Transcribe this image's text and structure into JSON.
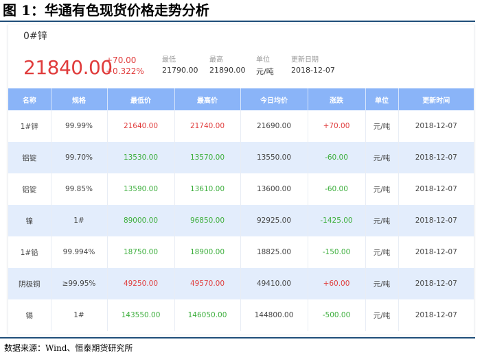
{
  "figure_title": "图 1：华通有色现货价格走势分析",
  "summary": {
    "product": "0#锌",
    "price": "21840.00",
    "change": "+70.00",
    "change_pct": "+0.322%",
    "low_label": "最低",
    "low_value": "21790.00",
    "high_label": "最高",
    "high_value": "21890.00",
    "unit_label": "单位",
    "unit_value": "元/吨",
    "date_label": "更新日期",
    "date_value": "2018-12-07"
  },
  "table": {
    "headers": [
      "名称",
      "规格",
      "最低价",
      "最高价",
      "今日均价",
      "涨跌",
      "单位",
      "更新时间"
    ],
    "rows": [
      {
        "name": "1#锌",
        "spec": "99.99%",
        "low": "21640.00",
        "high": "21740.00",
        "avg": "21690.00",
        "chg": "+70.00",
        "unit": "元/吨",
        "time": "2018-12-07",
        "dir": "up"
      },
      {
        "name": "铝锭",
        "spec": "99.70%",
        "low": "13530.00",
        "high": "13570.00",
        "avg": "13550.00",
        "chg": "-60.00",
        "unit": "元/吨",
        "time": "2018-12-07",
        "dir": "down"
      },
      {
        "name": "铝锭",
        "spec": "99.85%",
        "low": "13590.00",
        "high": "13610.00",
        "avg": "13600.00",
        "chg": "-60.00",
        "unit": "元/吨",
        "time": "2018-12-07",
        "dir": "down"
      },
      {
        "name": "镍",
        "spec": "1#",
        "low": "89000.00",
        "high": "96850.00",
        "avg": "92925.00",
        "chg": "-1425.00",
        "unit": "元/吨",
        "time": "2018-12-07",
        "dir": "down"
      },
      {
        "name": "1#铅",
        "spec": "99.994%",
        "low": "18750.00",
        "high": "18900.00",
        "avg": "18825.00",
        "chg": "-150.00",
        "unit": "元/吨",
        "time": "2018-12-07",
        "dir": "down"
      },
      {
        "name": "阴极铜",
        "spec": "≥99.95%",
        "low": "49250.00",
        "high": "49570.00",
        "avg": "49410.00",
        "chg": "+60.00",
        "unit": "元/吨",
        "time": "2018-12-07",
        "dir": "up"
      },
      {
        "name": "锡",
        "spec": "1#",
        "low": "143550.00",
        "high": "146050.00",
        "avg": "144800.00",
        "chg": "-500.00",
        "unit": "元/吨",
        "time": "2018-12-07",
        "dir": "down"
      }
    ]
  },
  "source": "数据来源：Wind、恒泰期货研究所",
  "colors": {
    "up": "#e03c3c",
    "down": "#3cae3c",
    "header": "#8ab4f8",
    "alt_row": "#e3edfc"
  }
}
